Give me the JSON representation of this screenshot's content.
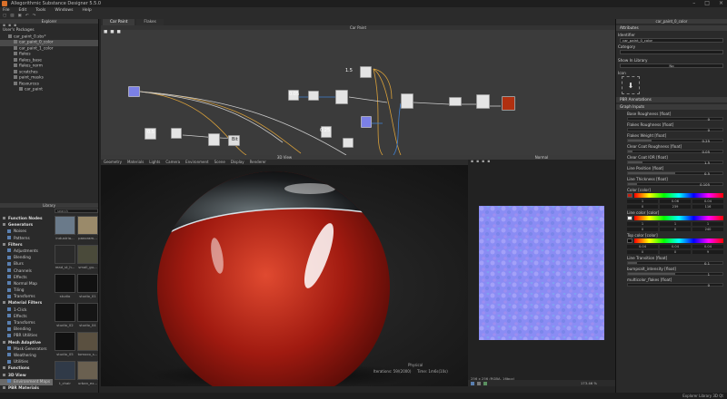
{
  "window": {
    "title": "Allegorithmic Substance Designer 5.5.0",
    "min_icon": "minimize-icon",
    "max_icon": "maximize-icon",
    "close_icon": "close-icon"
  },
  "menu": [
    "File",
    "Edit",
    "Tools",
    "Windows",
    "Help"
  ],
  "explorer": {
    "title": "Explorer",
    "items": [
      {
        "label": "User's Packages",
        "level": 0
      },
      {
        "label": "car_paint_0.sbs*",
        "level": 1,
        "icon": "package-icon"
      },
      {
        "label": "car_paint_0_color",
        "level": 2,
        "selected": true,
        "icon": "graph-icon"
      },
      {
        "label": "car_paint_1_color",
        "level": 2,
        "icon": "graph-icon"
      },
      {
        "label": "flakes",
        "level": 2,
        "icon": "graph-icon"
      },
      {
        "label": "flakes_base",
        "level": 2,
        "icon": "graph-icon"
      },
      {
        "label": "flakes_norm",
        "level": 2,
        "icon": "graph-icon"
      },
      {
        "label": "scratches",
        "level": 2,
        "icon": "graph-icon"
      },
      {
        "label": "paint_masks",
        "level": 2,
        "icon": "graph-icon"
      },
      {
        "label": "Resources",
        "level": 2,
        "icon": "folder-icon"
      },
      {
        "label": "car_paint",
        "level": 3,
        "icon": "resource-icon"
      }
    ]
  },
  "library": {
    "title": "Library",
    "search_placeholder": "search",
    "categories": [
      {
        "label": "Function Nodes",
        "header": true
      },
      {
        "label": "Generators",
        "header": true
      },
      {
        "label": "Noises"
      },
      {
        "label": "Patterns"
      },
      {
        "label": "Filters",
        "header": true
      },
      {
        "label": "Adjustments"
      },
      {
        "label": "Blending"
      },
      {
        "label": "Blurs"
      },
      {
        "label": "Channels"
      },
      {
        "label": "Effects"
      },
      {
        "label": "Normal Map"
      },
      {
        "label": "Tiling"
      },
      {
        "label": "Transforms"
      },
      {
        "label": "Material Filters",
        "header": true
      },
      {
        "label": "1-Click"
      },
      {
        "label": "Effects"
      },
      {
        "label": "Transforms"
      },
      {
        "label": "Blending"
      },
      {
        "label": "PBR Utilities"
      },
      {
        "label": "Mesh Adaptive",
        "header": true
      },
      {
        "label": "Mask Generators"
      },
      {
        "label": "Weathering"
      },
      {
        "label": "Utilities"
      },
      {
        "label": "Functions",
        "header": true
      },
      {
        "label": "3D View",
        "header": true
      },
      {
        "label": "Environment Maps",
        "selected": true
      },
      {
        "label": "PBR Materials",
        "header": true
      }
    ],
    "thumbs": [
      "industria...",
      "panoram...",
      "read_st_h...",
      "small_gu...",
      "studio",
      "studio_01",
      "studio_02",
      "studio_04",
      "studio_05",
      "tomoco_s...",
      "t_chair",
      "urban_ex..."
    ]
  },
  "graph": {
    "tabs": [
      "Car Paint",
      "Flakes"
    ],
    "title": "Car Paint",
    "node_labels": {
      "n1": "1.5",
      "n2": "0.05",
      "n3": "0.5",
      "n4": "Bit",
      "n5": "0.25"
    }
  },
  "view3d": {
    "title": "3D View",
    "menu": [
      "Geometry",
      "Materials",
      "Lights",
      "Camera",
      "Environment",
      "Scene",
      "Display",
      "Renderer"
    ],
    "status1": "Physical",
    "status2": "Iterations: 59/(2000)",
    "status3": "Time: 1m6s(10s)"
  },
  "view2d": {
    "title": "Normal",
    "info": "256 x 256 (RGBA, 16bpc)",
    "zoom": "173.46 %"
  },
  "attributes": {
    "title": "car_paint_0_color",
    "section1": "Attributes",
    "identifier_label": "Identifier",
    "identifier_value": "car_paint_0_color",
    "category_label": "Category",
    "show_in_library_label": "Show In Library",
    "show_in_library_value": "No",
    "icon_label": "Icon",
    "pbr_annotations": "PBR Annotations",
    "graph_inputs": "Graph Inputs",
    "params": [
      {
        "label": "Base Roughness [float]",
        "value": "0",
        "fill": 0.0
      },
      {
        "label": "Flakes Roughness [float]",
        "value": "0",
        "fill": 0.0
      },
      {
        "label": "Flakes Weight [float]",
        "value": "0.25",
        "fill": 0.25
      },
      {
        "label": "Clear Coat Roughness [float]",
        "value": "0.05",
        "fill": 0.05
      },
      {
        "label": "Clear Coat IOR [float]",
        "value": "1.5",
        "fill": 0.15
      },
      {
        "label": "Line Position [float]",
        "value": "0.5",
        "fill": 0.5
      },
      {
        "label": "Line Thickness [float]",
        "value": "0.105",
        "fill": 0.1
      }
    ],
    "colors": [
      {
        "label": "Color [color]",
        "swatch": "#c21d10",
        "r": "1",
        "g": "0.06",
        "b": "0.04",
        "hue": "0",
        "sat": "239",
        "lum": "116"
      },
      {
        "label": "Line color [color]",
        "swatch": "#ffffff",
        "r": "1",
        "g": "1",
        "b": "1",
        "hue": "0",
        "sat": "0",
        "lum": "240"
      },
      {
        "label": "Top color [color]",
        "swatch": "#0b0b0b",
        "r": "0.04",
        "g": "0.04",
        "b": "0.04",
        "hue": "0",
        "sat": "0",
        "lum": "9"
      }
    ],
    "params2": [
      {
        "label": "Line Transition [float]",
        "value": "0.1",
        "fill": 0.1
      },
      {
        "label": "bumpsalt_intensity [float]",
        "value": "1",
        "fill": 0.5
      },
      {
        "label": "multicolor_flakes [float]",
        "value": "0",
        "fill": 0.0
      }
    ]
  },
  "status_text": "Explorer  Library  3D  Qt"
}
